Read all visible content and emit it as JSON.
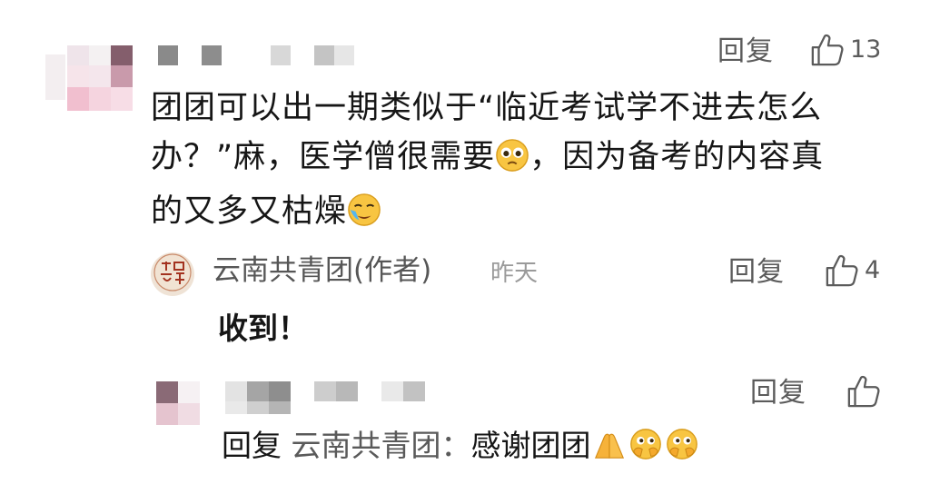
{
  "comment": {
    "text_line1": "团团可以出一期类似于“临近考试学不进去怎么",
    "text_line2a": "办？”麻，医学僧很需要",
    "text_line2b": "，因为备考的内容真",
    "text_line3": "的又多又枯燥",
    "reply_label": "回复",
    "like_count": "13",
    "emoji_1": "pleading-face",
    "emoji_2": "crying-face"
  },
  "author_reply": {
    "author": "云南共青团(作者)",
    "time": "昨天",
    "text": "收到！",
    "reply_label": "回复",
    "like_count": "4",
    "avatar_icon": "seal-logo"
  },
  "sub_reply": {
    "reply_label": "回复",
    "prefix": "回复",
    "target": "云南共青团：",
    "text": "感谢团团",
    "emojis": [
      "folded-hands",
      "peeking-face",
      "peeking-face"
    ]
  },
  "colors": {
    "text": "#161616",
    "muted": "#5b5b5b",
    "time": "#9a9a9a",
    "blur_dark": "#8c8c8c",
    "blur_light": "#d9d9d9",
    "blur_pink": "#e9c9d2"
  }
}
